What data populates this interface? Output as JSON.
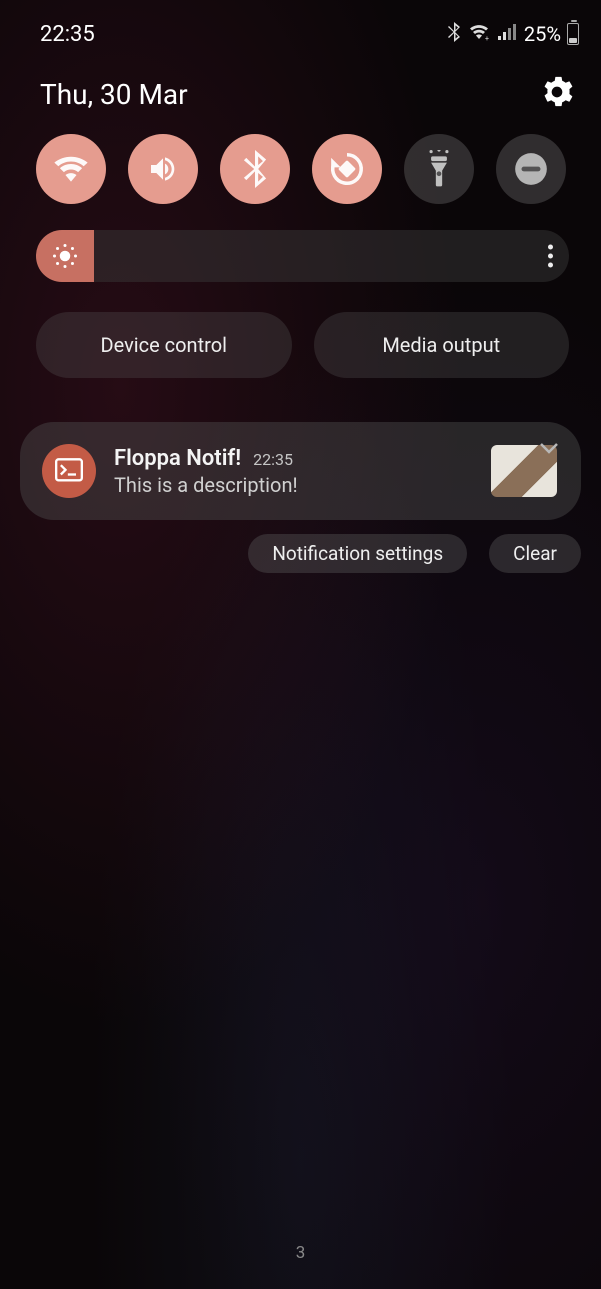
{
  "status": {
    "time": "22:35",
    "battery_pct": "25%"
  },
  "header": {
    "date": "Thu, 30 Mar"
  },
  "quick_settings": {
    "toggles": [
      {
        "name": "wifi",
        "on": true
      },
      {
        "name": "sound",
        "on": true
      },
      {
        "name": "bluetooth",
        "on": true
      },
      {
        "name": "rotate",
        "on": true
      },
      {
        "name": "flashlight",
        "on": false
      },
      {
        "name": "dnd",
        "on": false
      }
    ]
  },
  "controls": {
    "device": "Device control",
    "media": "Media output"
  },
  "notification": {
    "title": "Floppa Notif!",
    "time": "22:35",
    "description": "This is a description!"
  },
  "actions": {
    "settings": "Notification settings",
    "clear": "Clear"
  },
  "nav": {
    "indicator": "3"
  }
}
